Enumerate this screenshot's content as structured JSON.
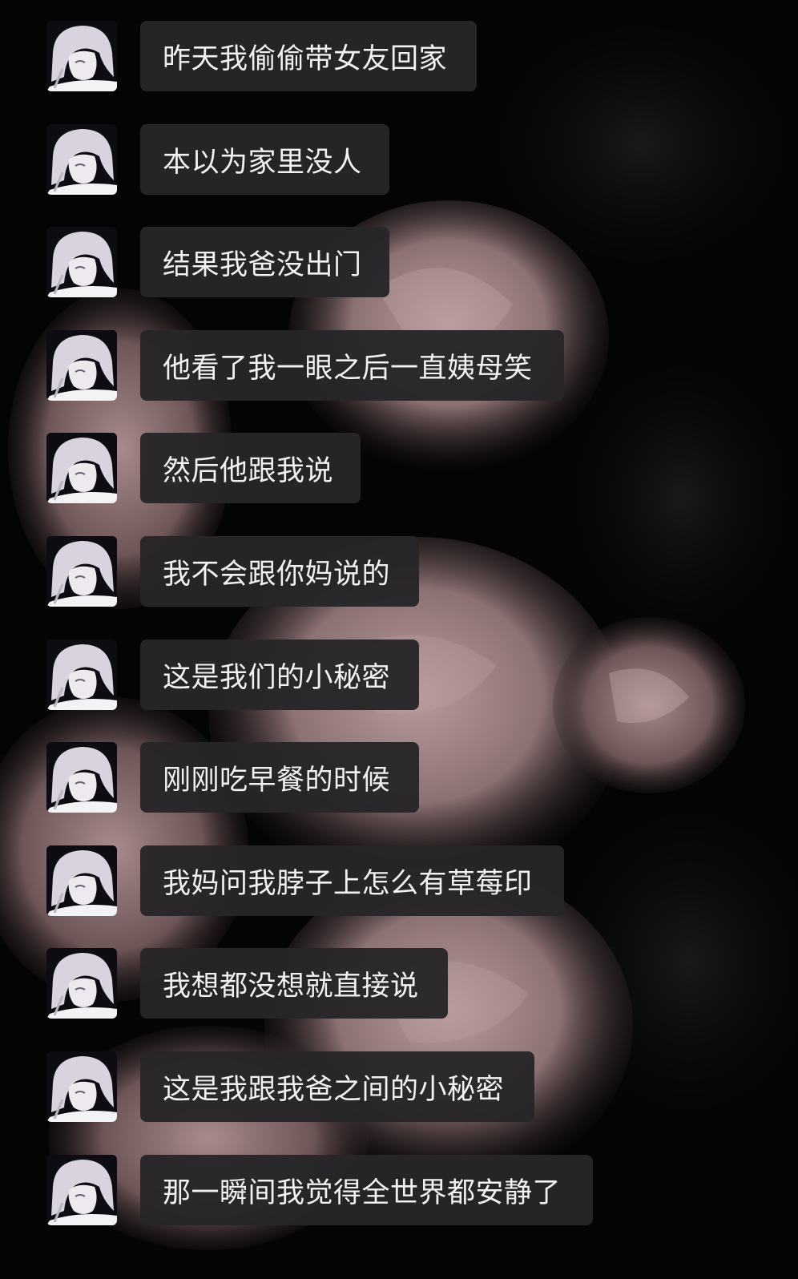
{
  "chat": {
    "avatar_icon": "anime-avatar-icon",
    "messages": [
      {
        "text": "昨天我偷偷带女友回家"
      },
      {
        "text": "本以为家里没人"
      },
      {
        "text": "结果我爸没出门"
      },
      {
        "text": "他看了我一眼之后一直姨母笑"
      },
      {
        "text": "然后他跟我说"
      },
      {
        "text": "我不会跟你妈说的"
      },
      {
        "text": "这是我们的小秘密"
      },
      {
        "text": "刚刚吃早餐的时候"
      },
      {
        "text": "我妈问我脖子上怎么有草莓印"
      },
      {
        "text": "我想都没想就直接说"
      },
      {
        "text": "这是我跟我爸之间的小秘密"
      },
      {
        "text": "那一瞬间我觉得全世界都安静了"
      }
    ]
  },
  "colors": {
    "bubble": "#262528",
    "text": "#f1f0f2",
    "background": "#060506",
    "rose": "#b89a9a"
  }
}
